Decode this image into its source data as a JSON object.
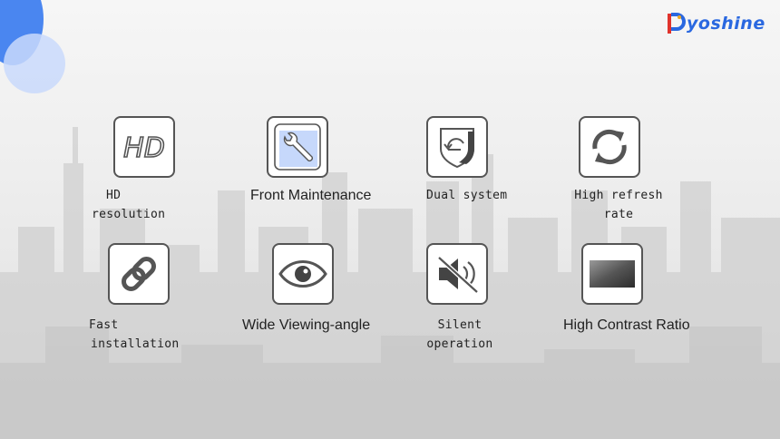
{
  "brand": {
    "name": "yoshine"
  },
  "colors": {
    "accent_blue": "#4a86f0",
    "light_blue": "#c9d9fb",
    "logo_blue": "#2a68e0",
    "border": "#555555"
  },
  "features": [
    {
      "icon": "hd-icon",
      "label_lines": [
        "HD",
        "resolution"
      ]
    },
    {
      "icon": "wrench-icon",
      "label_lines": [
        "Front Maintenance"
      ]
    },
    {
      "icon": "shield-icon",
      "label_lines": [
        "Dual system"
      ]
    },
    {
      "icon": "refresh-icon",
      "label_lines": [
        "High refresh",
        "rate"
      ]
    },
    {
      "icon": "link-icon",
      "label_lines": [
        "Fast",
        "installation"
      ]
    },
    {
      "icon": "eye-icon",
      "label_lines": [
        "Wide Viewing-angle"
      ]
    },
    {
      "icon": "mute-icon",
      "label_lines": [
        "Silent",
        "operation"
      ]
    },
    {
      "icon": "contrast-icon",
      "label_lines": [
        "High Contrast Ratio"
      ]
    }
  ]
}
